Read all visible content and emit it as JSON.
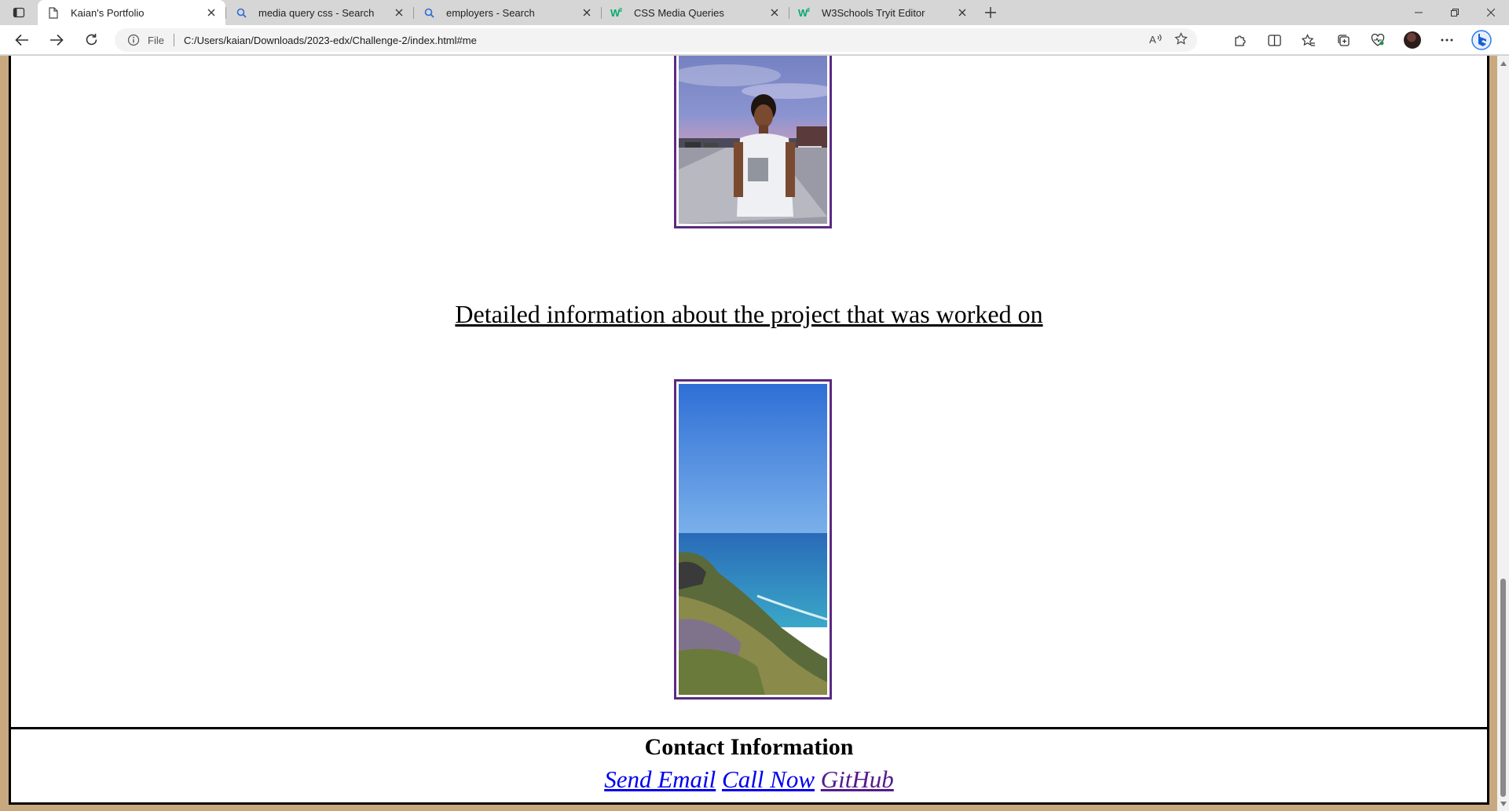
{
  "browser": {
    "tabs": [
      {
        "title": "Kaian's Portfolio",
        "icon": "page-icon",
        "active": true
      },
      {
        "title": "media query css - Search",
        "icon": "search-icon",
        "active": false
      },
      {
        "title": "employers - Search",
        "icon": "search-icon",
        "active": false
      },
      {
        "title": "CSS Media Queries",
        "icon": "w3schools-icon",
        "active": false
      },
      {
        "title": "W3Schools Tryit Editor",
        "icon": "w3schools-icon",
        "active": false
      }
    ],
    "address": {
      "scheme_label": "File",
      "url": "C:/Users/kaian/Downloads/2023-edx/Challenge-2/index.html#me"
    }
  },
  "page": {
    "project_text": "Detailed information about the project that was worked on",
    "photos": [
      {
        "subject": "person-photo"
      },
      {
        "subject": "coastline-photo"
      }
    ],
    "footer": {
      "title": "Contact Information",
      "links": [
        {
          "label": "Send Email",
          "color": "#0000ee"
        },
        {
          "label": "Call Now",
          "color": "#0000ee"
        },
        {
          "label": "GitHub",
          "color": "#551a8b"
        }
      ]
    }
  },
  "colors": {
    "page_background": "#c8a97f",
    "photo_border": "#5a2a82"
  },
  "scroll": {
    "position_fraction": 0.96
  }
}
